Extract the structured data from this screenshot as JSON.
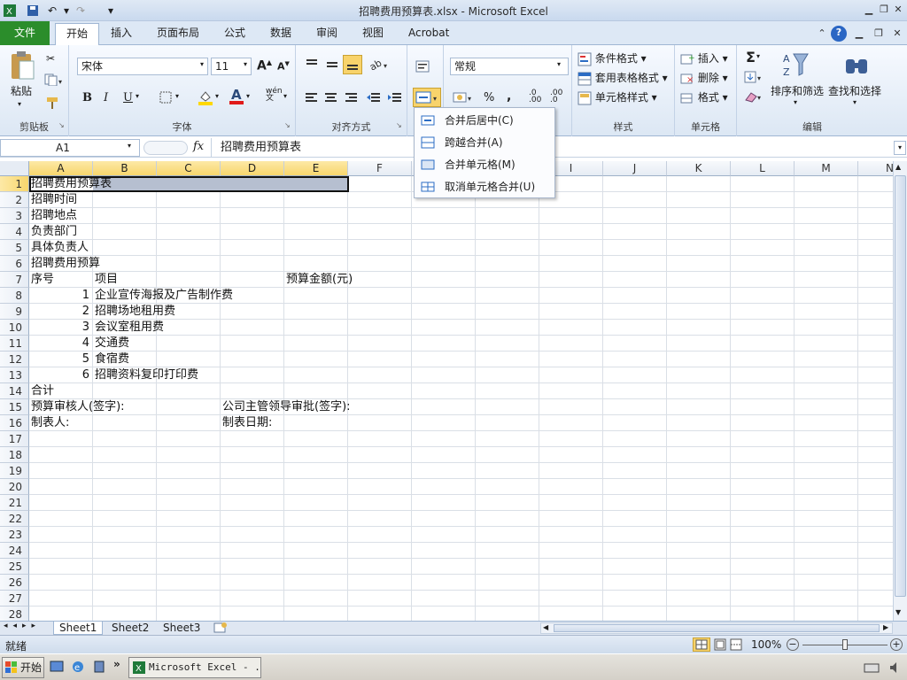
{
  "window": {
    "title": "招聘费用预算表.xlsx - Microsoft Excel"
  },
  "ribbon_tabs": [
    "文件",
    "开始",
    "插入",
    "页面布局",
    "公式",
    "数据",
    "审阅",
    "视图",
    "Acrobat"
  ],
  "clipboard": {
    "paste_label": "粘贴",
    "group_label": "剪贴板"
  },
  "font": {
    "name": "宋体",
    "size": "11",
    "group_label": "字体",
    "bold": "B",
    "italic": "I",
    "underline": "U",
    "phonetic": "wén"
  },
  "alignment": {
    "group_label": "对齐方式"
  },
  "number": {
    "format": "常规",
    "percent": "%",
    "comma": ","
  },
  "styles": {
    "conditional": "条件格式",
    "table": "套用表格格式",
    "cell": "单元格样式",
    "group_label": "样式"
  },
  "cells_group": {
    "insert": "插入",
    "delete": "删除",
    "format": "格式",
    "group_label": "单元格"
  },
  "editing": {
    "sum": "Σ",
    "sort": "排序和筛选",
    "find": "查找和选择",
    "group_label": "编辑"
  },
  "formula_bar": {
    "name_box": "A1",
    "fx": "fx",
    "value": "招聘费用预算表"
  },
  "merge_menu": {
    "items": [
      "合并后居中(C)",
      "跨越合并(A)",
      "合并单元格(M)",
      "取消单元格合并(U)"
    ]
  },
  "columns": [
    "A",
    "B",
    "C",
    "D",
    "E",
    "F",
    "G",
    "H",
    "I",
    "J",
    "K",
    "L",
    "M",
    "N"
  ],
  "rows": [
    "1",
    "2",
    "3",
    "4",
    "5",
    "6",
    "7",
    "8",
    "9",
    "10",
    "11",
    "12",
    "13",
    "14",
    "15",
    "16",
    "17",
    "18",
    "19",
    "20",
    "21",
    "22",
    "23",
    "24",
    "25",
    "26",
    "27",
    "28"
  ],
  "cells": {
    "A1": "招聘费用预算表",
    "A2": "招聘时间",
    "A3": "招聘地点",
    "A4": "负责部门",
    "A5": "具体负责人",
    "A6": "招聘费用预算",
    "A7": "序号",
    "B7": "项目",
    "E7": "预算金额(元)",
    "A8": "1",
    "B8": "企业宣传海报及广告制作费",
    "A9": "2",
    "B9": "招聘场地租用费",
    "A10": "3",
    "B10": "会议室租用费",
    "A11": "4",
    "B11": "交通费",
    "A12": "5",
    "B12": "食宿费",
    "A13": "6",
    "B13": "招聘资料复印打印费",
    "A14": "合计",
    "A15": "预算审核人(签字):",
    "D15": "公司主管领导审批(签字):",
    "A16": "制表人:",
    "D16": "制表日期:"
  },
  "sheet_tabs": [
    "Sheet1",
    "Sheet2",
    "Sheet3"
  ],
  "status": {
    "ready": "就绪",
    "zoom": "100%"
  },
  "taskbar": {
    "start": "开始",
    "task": "Microsoft Excel - ..."
  }
}
